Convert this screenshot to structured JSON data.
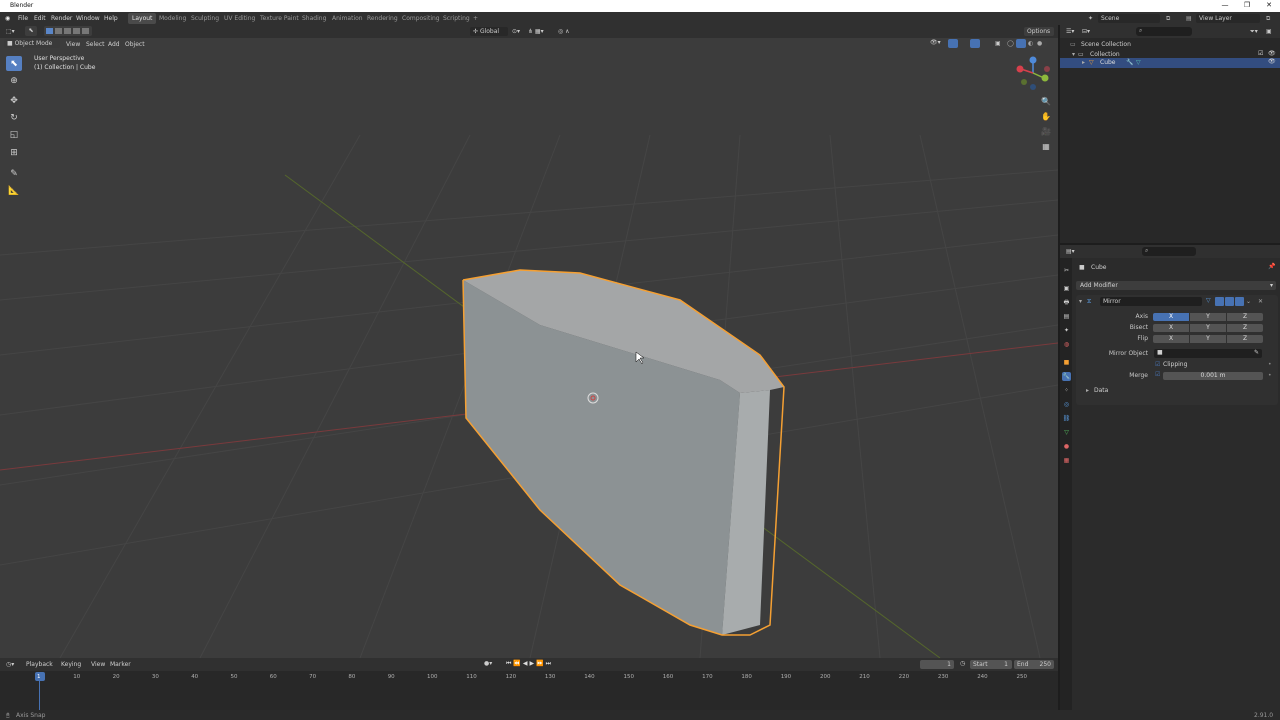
{
  "window": {
    "title": "Blender",
    "controls": [
      "—",
      "❐",
      "✕"
    ]
  },
  "menu": [
    "File",
    "Edit",
    "Render",
    "Window",
    "Help"
  ],
  "workspaces": [
    "Layout",
    "Modeling",
    "Sculpting",
    "UV Editing",
    "Texture Paint",
    "Shading",
    "Animation",
    "Rendering",
    "Compositing",
    "Scripting",
    "+"
  ],
  "active_workspace": "Layout",
  "scene": {
    "name": "Scene",
    "view_layer": "View Layer"
  },
  "viewport": {
    "mode": "Object Mode",
    "menus": [
      "View",
      "Select",
      "Add",
      "Object"
    ],
    "transform_orientation": "Global",
    "options_label": "Options",
    "overlay_line1": "User Perspective",
    "overlay_line2": "(1) Collection | Cube",
    "gizmo_axes": [
      "X",
      "Y",
      "Z"
    ]
  },
  "outliner": {
    "rows": [
      {
        "label": "Scene Collection"
      },
      {
        "label": "Collection"
      },
      {
        "label": "Cube"
      }
    ]
  },
  "properties": {
    "object_name": "Cube",
    "add_modifier": "Add Modifier",
    "modifier_name": "Mirror",
    "axis_label": "Axis",
    "bisect_label": "Bisect",
    "flip_label": "Flip",
    "axes": [
      "X",
      "Y",
      "Z"
    ],
    "mirror_object_label": "Mirror Object",
    "clipping_label": "Clipping",
    "merge_label": "Merge",
    "merge_value": "0.001 m",
    "data_label": "Data"
  },
  "timeline": {
    "menus": [
      "Playback",
      "Keying",
      "View",
      "Marker"
    ],
    "current_frame": "1",
    "start_label": "Start",
    "start": "1",
    "end_label": "End",
    "end": "250",
    "ticks": [
      "1",
      "10",
      "20",
      "30",
      "40",
      "50",
      "60",
      "70",
      "80",
      "90",
      "100",
      "110",
      "120",
      "130",
      "140",
      "150",
      "160",
      "170",
      "180",
      "190",
      "200",
      "210",
      "220",
      "230",
      "240",
      "250"
    ]
  },
  "status": {
    "left": "Axis Snap",
    "version": "2.91.0"
  },
  "colors": {
    "accent": "#4772b3",
    "selection": "#f5a033",
    "x_axis": "#a13a3e",
    "y_axis": "#6b8a2f"
  }
}
